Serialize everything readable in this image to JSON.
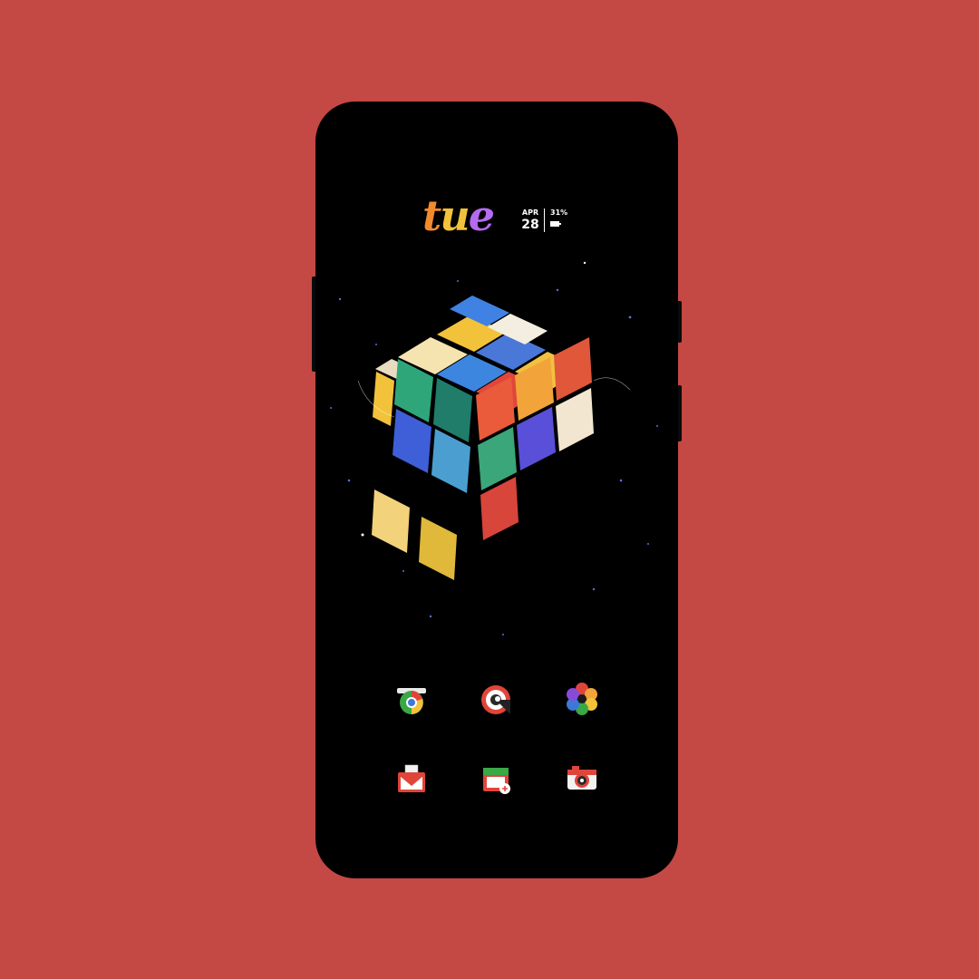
{
  "widget": {
    "day": [
      "t",
      "u",
      "e"
    ],
    "month": "APR",
    "day_number": "28",
    "battery_percent": "31%"
  },
  "dock_row_1": [
    {
      "name": "chrome-style-browser-icon"
    },
    {
      "name": "chat-bubble-icon"
    },
    {
      "name": "photos-flower-icon"
    }
  ],
  "dock_row_2": [
    {
      "name": "gmail-icon"
    },
    {
      "name": "calendar-icon"
    },
    {
      "name": "camera-icon"
    }
  ],
  "colors": {
    "background": "#c44844",
    "screen": "#000000",
    "accent_orange": "#f28a2e",
    "accent_yellow": "#f2c23b",
    "accent_purple": "#b46bf0"
  }
}
